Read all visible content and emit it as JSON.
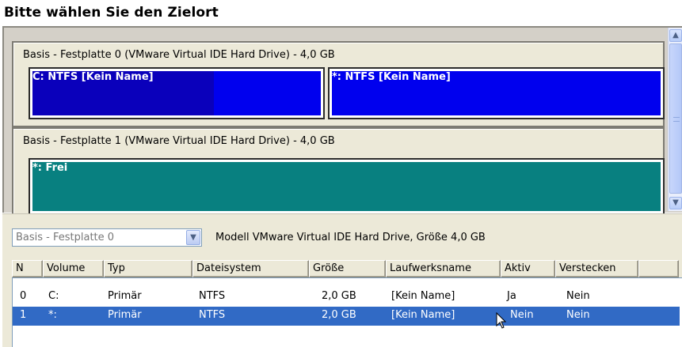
{
  "title": "Bitte wählen Sie den Zielort",
  "disk_map": {
    "disks": [
      {
        "label": "Basis - Festplatte 0 (VMware Virtual IDE Hard Drive) - 4,0 GB",
        "partitions": [
          {
            "name": "C: NTFS [Kein Name]",
            "color": "#0000ee"
          },
          {
            "name": "*: NTFS [Kein Name]",
            "color": "#0000ee"
          }
        ]
      },
      {
        "label": "Basis - Festplatte 1 (VMware Virtual IDE Hard Drive) - 4,0 GB",
        "partitions": [
          {
            "name": "*: Frei",
            "color": "#088080"
          }
        ]
      }
    ],
    "scrollbar": {
      "up_icon": "chevron-up-icon",
      "down_icon": "chevron-down-icon"
    }
  },
  "details": {
    "disk_select": {
      "value": "Basis - Festplatte 0",
      "icon": "chevron-down-icon"
    },
    "model_info": "Modell VMware Virtual IDE Hard Drive, Größe 4,0 GB",
    "columns": [
      "N",
      "Volume",
      "Typ",
      "Dateisystem",
      "Größe",
      "Laufwerksname",
      "Aktiv",
      "Verstecken"
    ],
    "rows": [
      {
        "n": "0",
        "volume": "C:",
        "typ": "Primär",
        "dateisystem": "NTFS",
        "groesse": "2,0 GB",
        "laufwerksname": "[Kein Name]",
        "aktiv": "Ja",
        "verstecken": "Nein",
        "selected": false
      },
      {
        "n": "1",
        "volume": "*:",
        "typ": "Primär",
        "dateisystem": "NTFS",
        "groesse": "2,0 GB",
        "laufwerksname": "[Kein Name]",
        "aktiv": "Nein",
        "verstecken": "Nein",
        "selected": true
      }
    ],
    "selection_color": "#316ac5"
  }
}
